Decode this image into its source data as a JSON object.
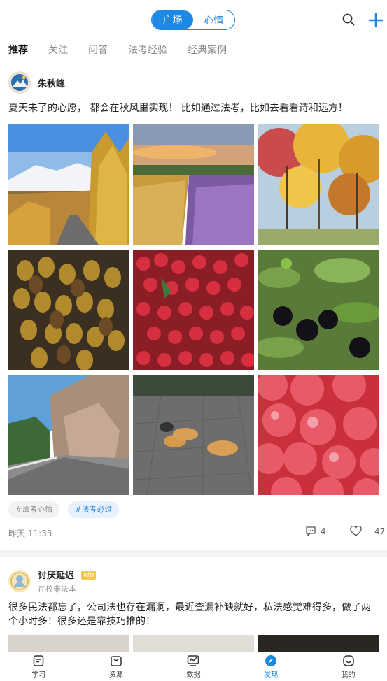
{
  "header": {
    "segment": {
      "left": "广场",
      "right": "心情",
      "selected": "广场"
    },
    "search_icon": "search-icon",
    "add_icon": "plus-icon",
    "accent": "#1e88e5"
  },
  "tabs": [
    {
      "label": "推荐",
      "active": true
    },
    {
      "label": "关注",
      "active": false
    },
    {
      "label": "问答",
      "active": false
    },
    {
      "label": "法考经验",
      "active": false
    },
    {
      "label": "经典案例",
      "active": false
    }
  ],
  "posts": [
    {
      "author": "朱秋峰",
      "text": "夏天未了的心愿， 都会在秋风里实现！ 比如通过法考，比如去看看诗和远方！",
      "images": [
        "雪山秋林公路",
        "薰衣草麦田",
        "秋日树林",
        "沙枣",
        "红山楂",
        "黑果枸杞",
        "山间公路",
        "校园小狗",
        "红苹果"
      ],
      "tags": [
        "#法考心情",
        "#法考必过"
      ],
      "time": "昨天 11:33",
      "comments": "4",
      "likes": "47"
    },
    {
      "author": "讨厌延迟",
      "badge": "vip",
      "subtitle": "在校非法本",
      "text": "很多民法都忘了，公司法也存在漏洞，最近查漏补缺就好，私法感觉难得多，做了两个小时多！很多还是靠技巧推的！"
    }
  ],
  "bottom_nav": [
    {
      "label": "学习",
      "icon": "study-icon",
      "active": false
    },
    {
      "label": "资源",
      "icon": "resource-icon",
      "active": false
    },
    {
      "label": "数据",
      "icon": "data-chart-icon",
      "active": false
    },
    {
      "label": "发现",
      "icon": "discover-compass-icon",
      "active": true
    },
    {
      "label": "我的",
      "icon": "profile-icon",
      "active": false
    }
  ]
}
